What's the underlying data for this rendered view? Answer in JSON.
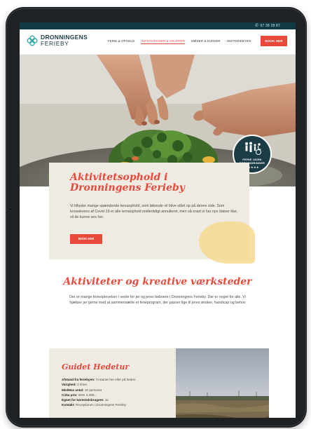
{
  "topbar": {
    "phone": "97 38 28 87"
  },
  "logo": {
    "line1": "DRONNINGENS",
    "line2": "FERIEBY"
  },
  "nav": {
    "items": [
      {
        "label": "FERIE & OPHOLD",
        "active": false
      },
      {
        "label": "INSTITUTIONER & GRUPPER",
        "active": true
      },
      {
        "label": "MØDER & KURSER",
        "active": false
      },
      {
        "label": "OM FERIEBYEN",
        "active": false
      }
    ],
    "book_label": "BOOK HER"
  },
  "badge": {
    "line1": "FERIE UDEN",
    "line2": "FORHINDRINGER",
    "stars": "★★★★★"
  },
  "intro": {
    "title": "Aktivitetsophold i Dronningens Ferieby",
    "body": "Vi tilbyder mange spændende temaophold, som løbende vil blive slået op på denne side. Som konsekvens af Covid-19 er alle temaophold midlertidigt annulleret, men så snart vi har nye datoer klar, vil de kunne ses her.",
    "button": "BOOK HER"
  },
  "section2": {
    "title": "Aktiviteter og kreative værksteder",
    "body": "Der er mange ferieoplevelser i vente for jer og jeres beboere i Dronningens Ferieby. Der er noget for alle. Vi hjælper jer gerne med at sammensætte et ferieprogram, der passer lige til jeres ønsker, handicap og behov"
  },
  "guide": {
    "title": "Guidet Hedetur",
    "rows": [
      {
        "label": "Afstand fra feriebyen:",
        "value": "Vi starter her eller på heden"
      },
      {
        "label": "Varighed:",
        "value": "2 timer"
      },
      {
        "label": "Min/Max antal:",
        "value": "10 personer"
      },
      {
        "label": "Cirka pris:",
        "value": "DKK 3.000,-"
      },
      {
        "label": "Egnet for kørestolsbrugere:",
        "value": "Ja"
      },
      {
        "label": "Kontakt:",
        "value": "Receptionen i Dronningens Ferieby"
      }
    ]
  },
  "colors": {
    "accent": "#e8493a",
    "navy": "#1b3b45",
    "card": "#efebe3",
    "yellow": "#f4d98f"
  }
}
